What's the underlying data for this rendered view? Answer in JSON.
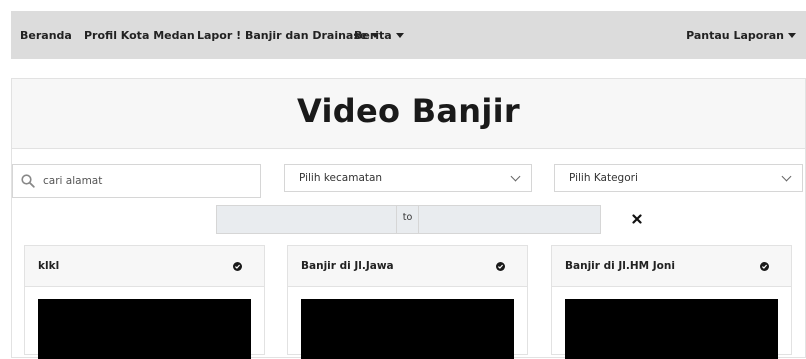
{
  "nav": {
    "items": [
      {
        "label": "Beranda",
        "dropdown": false
      },
      {
        "label": "Profil Kota Medan",
        "dropdown": false
      },
      {
        "label": "Lapor ! Banjir dan Drainase",
        "dropdown": true
      },
      {
        "label": "Berita",
        "dropdown": true
      }
    ],
    "right": {
      "label": "Pantau Laporan",
      "dropdown": true
    }
  },
  "page": {
    "title": "Video Banjir"
  },
  "filters": {
    "search_placeholder": "cari alamat",
    "kecamatan": "Pilih kecamatan",
    "kategori": "Pilih Kategori",
    "date_separator": "to"
  },
  "videos": [
    {
      "title": "klkl"
    },
    {
      "title": "Banjir di Jl.Jawa"
    },
    {
      "title": "Banjir di Jl.HM Joni"
    }
  ],
  "colors": {
    "navbar": "#dcdcdc",
    "header": "#f7f7f7",
    "date_field": "#e9ecef",
    "video": "#000000"
  }
}
